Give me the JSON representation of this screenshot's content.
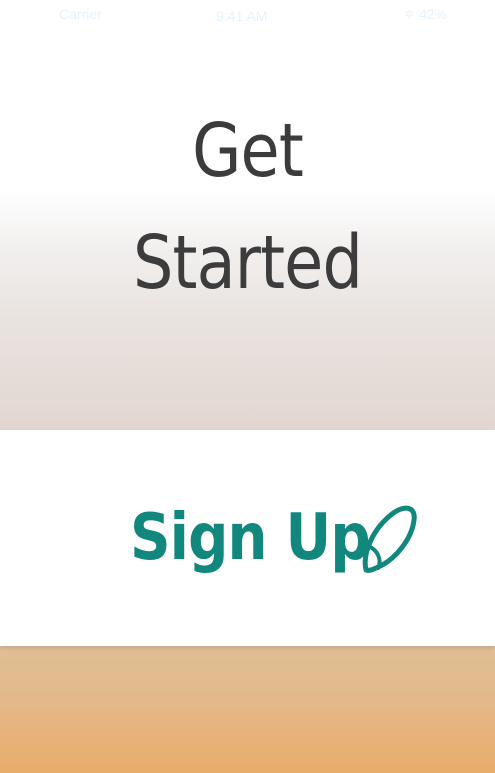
{
  "status_bar": {
    "carrier": "Carrier",
    "time": "9:41 AM",
    "battery_level": "42%",
    "battery_icon": "battery-icon",
    "bluetooth_icon": "bluetooth-icon"
  },
  "welcome": {
    "line1": "Get",
    "line2": "Started"
  },
  "signup": {
    "label": "Sign Up",
    "icon": "leaf-icon",
    "color": "#12877d"
  },
  "colors": {
    "top_gradient_end": "#e2d6cf",
    "bottom_gradient_start": "#dfbe94",
    "bottom_gradient_end": "#e8ac6a",
    "heading_text": "#3c3c3c"
  }
}
